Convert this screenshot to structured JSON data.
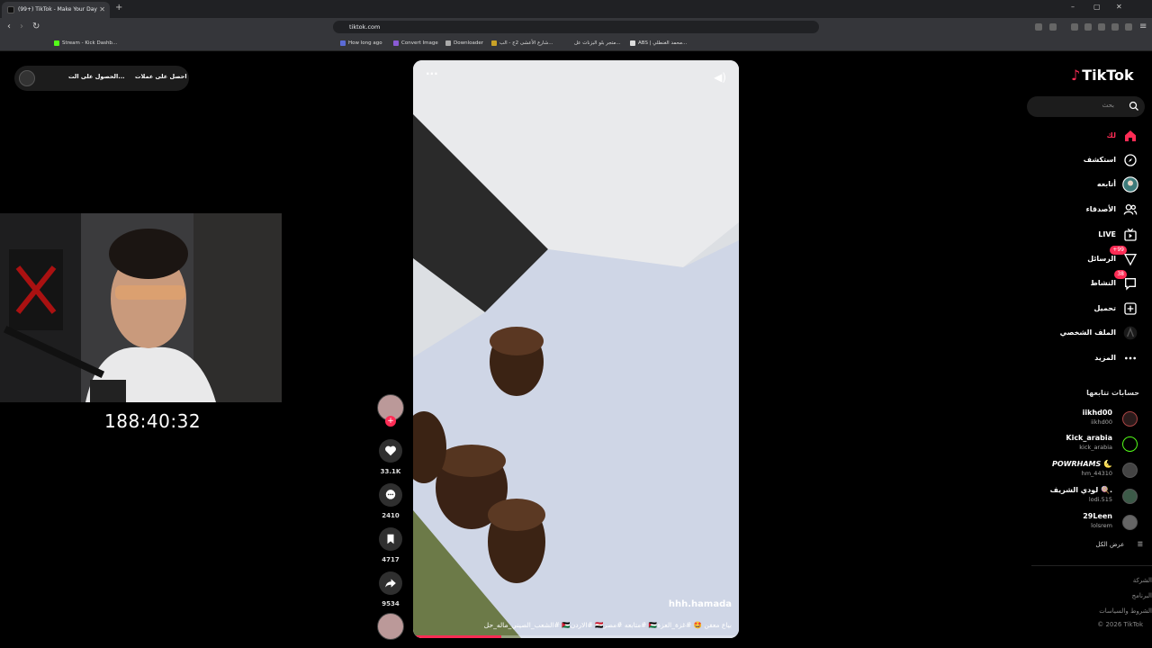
{
  "browser": {
    "tab_title": "(99+) TikTok - Make Your Day",
    "url": "tiktok.com",
    "bookmarks": [
      "Stream - Kick Dashb...",
      "How long ago",
      "Convert Image",
      "Downloader",
      "شارع الأعشى 2ج - الب...",
      "متجر بلو البزنات عل...",
      "ABS | محمد الغنطلي..."
    ]
  },
  "overlay": {
    "promo_1": "احصل على عملات",
    "promo_2": "الحصول على الت...",
    "timer": "188:40:32"
  },
  "video": {
    "username": "hhh.hamada",
    "caption": "بياع معفن 🤩 #غزة_العزة🇵🇸 #متابعه #مصر🇪🇬 #الاردن🇯🇴 #الشعب_الصيني_ماله_حل",
    "progress": 0.27
  },
  "actions": {
    "likes": "33.1K",
    "comments": "2410",
    "saves": "4717",
    "shares": "9534"
  },
  "sidebar": {
    "logo": "TikTok",
    "search_placeholder": "بحث",
    "nav": [
      {
        "label": "لك",
        "icon": "home-icon",
        "active": true
      },
      {
        "label": "استكشف",
        "icon": "compass-icon"
      },
      {
        "label": "أتابعه",
        "icon": "following-avatar-icon"
      },
      {
        "label": "الأصدقاء",
        "icon": "friends-icon"
      },
      {
        "label": "LIVE",
        "icon": "live-icon"
      },
      {
        "label": "الرسائل",
        "icon": "messages-icon",
        "badge": "+99"
      },
      {
        "label": "النشاط",
        "icon": "activity-icon",
        "badge": "38"
      },
      {
        "label": "تحميل",
        "icon": "upload-icon"
      },
      {
        "label": "الملف الشخصي",
        "icon": "profile-icon"
      },
      {
        "label": "المزيد",
        "icon": "more-icon"
      }
    ],
    "following_title": "حسابات تتابعها",
    "following": [
      {
        "name": "iikhd00",
        "handle": "iikhd00"
      },
      {
        "name": "Kick_arabia",
        "handle": "kick_arabia"
      },
      {
        "name": "𝙋𝙊𝙒𝙍𝙃𝘼𝙈𝙎 🌜",
        "handle": "hm_44310"
      },
      {
        "name": "لودي الشريف 🍭.",
        "handle": "lodi.515"
      },
      {
        "name": "29Leen",
        "handle": "lolsrem"
      }
    ],
    "see_all": "عرض الكل",
    "footer": [
      "الشركة",
      "البرنامج",
      "الشروط والسياسات",
      "© 2026 TikTok"
    ]
  },
  "colors": {
    "accent": "#fe2c55",
    "background": "#000000"
  }
}
